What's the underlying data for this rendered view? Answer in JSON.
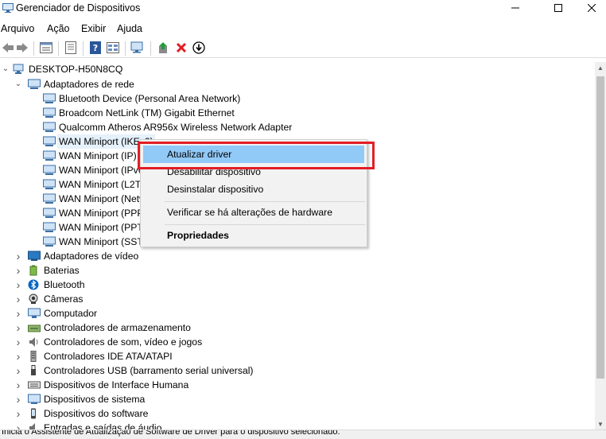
{
  "window": {
    "title": "Gerenciador de Dispositivos",
    "icon": "device-manager-icon",
    "controls": [
      "minimize-icon",
      "maximize-icon",
      "close-icon"
    ]
  },
  "menubar": [
    "Arquivo",
    "Ação",
    "Exibir",
    "Ajuda"
  ],
  "toolbar": [
    "back-arrow-icon",
    "forward-arrow-icon",
    "properties-icon",
    "help-icon",
    "view-icon",
    "scan-hardware-icon",
    "add-driver-icon",
    "uninstall-icon",
    "download-icon"
  ],
  "tree": {
    "root": "DESKTOP-H50N8CQ",
    "expanded_category": "Adaptadores de rede",
    "network_adapters": [
      "Bluetooth Device (Personal Area Network)",
      "Broadcom NetLink (TM) Gigabit Ethernet",
      "Qualcomm Atheros AR956x Wireless Network Adapter",
      "WAN Miniport (IKEv2)",
      "WAN Miniport (IP)",
      "WAN Miniport (IPv6)",
      "WAN Miniport (L2TP)",
      "WAN Miniport (Network Monitor)",
      "WAN Miniport (PPPOE)",
      "WAN Miniport (PPTP)",
      "WAN Miniport (SSTP)"
    ],
    "selected_item": "WAN Miniport (IKEv2)",
    "categories": [
      "Adaptadores de vídeo",
      "Baterias",
      "Bluetooth",
      "Câmeras",
      "Computador",
      "Controladores de armazenamento",
      "Controladores de som, vídeo e jogos",
      "Controladores IDE ATA/ATAPI",
      "Controladores USB (barramento serial universal)",
      "Dispositivos de Interface Humana",
      "Dispositivos de sistema",
      "Dispositivos do software",
      "Entradas e saídas de áudio"
    ]
  },
  "context_menu": {
    "items": [
      {
        "label": "Atualizar driver",
        "highlighted": true
      },
      {
        "label": "Desabilitar dispositivo"
      },
      {
        "label": "Desinstalar dispositivo"
      },
      {
        "label": "Verificar se há alterações de hardware"
      },
      {
        "label": "Propriedades",
        "bold": true
      }
    ],
    "highlight_color": "#91c9f7",
    "annotation_color": "#e21e26"
  },
  "statusbar": {
    "text": "Inicia o Assistente de Atualização de Software de Driver para o dispositivo selecionado."
  }
}
